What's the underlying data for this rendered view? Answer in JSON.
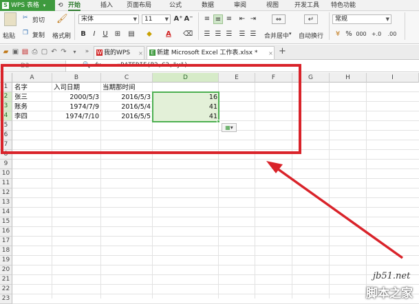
{
  "app": {
    "title": "WPS 表格",
    "logo": "S"
  },
  "menus": [
    "开始",
    "插入",
    "页面布局",
    "公式",
    "数据",
    "审阅",
    "视图",
    "开发工具",
    "特色功能"
  ],
  "active_menu": "开始",
  "ribbon": {
    "cut": "剪切",
    "copy": "复制",
    "paste": "粘贴",
    "format_painter": "格式刷",
    "font_name": "宋体",
    "font_size": "11",
    "merge_center": "合并居中",
    "wrap_text": "自动换行",
    "number_format": "常规",
    "percent": "%",
    "thousands": "000",
    "inc_decimal": "+.0",
    "dec_decimal": ".00",
    "bold": "B",
    "italic": "I",
    "underline": "U",
    "font_color_letter": "A"
  },
  "tabs": [
    {
      "label": "我的WPS",
      "icon": "W"
    },
    {
      "label": "新建 Microsoft Excel 工作表.xlsx *",
      "icon": "E"
    }
  ],
  "formula_bar": {
    "cell_ref": "D2",
    "fx": "fx",
    "formula": "=DATEDIF(B2,C2,\"y\")"
  },
  "sheet": {
    "columns": [
      "A",
      "B",
      "C",
      "D",
      "E",
      "F",
      "G",
      "H",
      "I"
    ],
    "rows": [
      "1",
      "2",
      "3",
      "4",
      "5",
      "6",
      "7",
      "8",
      "9",
      "10",
      "11",
      "12",
      "13",
      "14",
      "15",
      "16",
      "17",
      "18",
      "19",
      "20",
      "21",
      "22",
      "23"
    ],
    "header_row": [
      "名字",
      "入司日期",
      "当期那时间"
    ],
    "data": [
      {
        "name": "张三",
        "hire_date": "2000/5/3",
        "current_date": "2016/5/3",
        "years": "16"
      },
      {
        "name": "账务",
        "hire_date": "1974/7/9",
        "current_date": "2016/5/4",
        "years": "41"
      },
      {
        "name": "李四",
        "hire_date": "1974/7/10",
        "current_date": "2016/5/5",
        "years": "41"
      }
    ]
  },
  "annotation": {
    "box_color": "#d9232a",
    "arrow_color": "#d9232a"
  },
  "watermark": {
    "site": "jb51.net",
    "brand": "脚本之家"
  },
  "colors": {
    "accent": "#3e9a3e",
    "selection": "#d6ebc8",
    "selection_border": "#4caf50"
  }
}
